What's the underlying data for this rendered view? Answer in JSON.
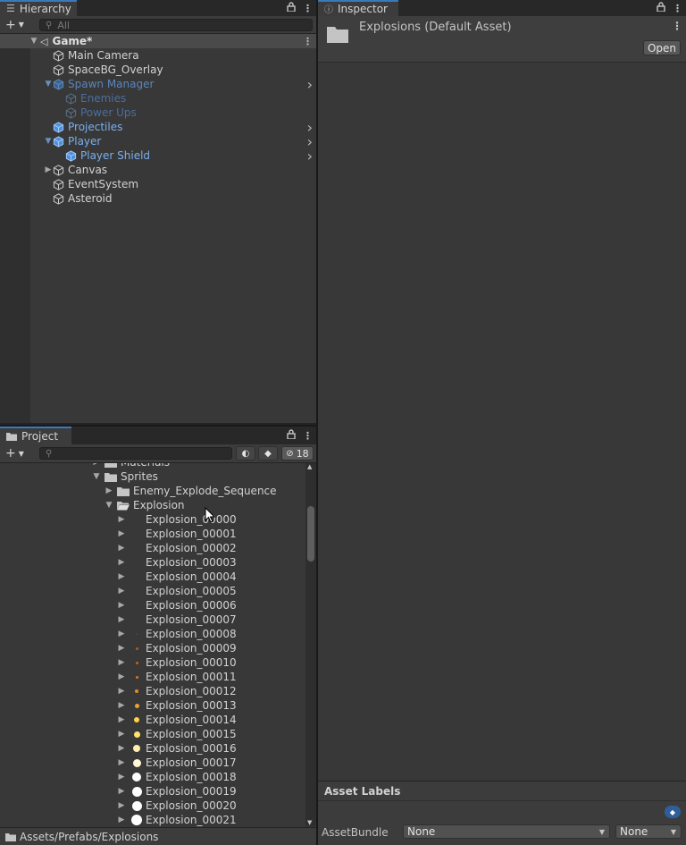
{
  "hierarchy": {
    "tab_label": "Hierarchy",
    "search_placeholder": "All",
    "scene_name": "Game*",
    "items": [
      {
        "label": "Main Camera",
        "indent": 1,
        "kind": "go"
      },
      {
        "label": "SpaceBG_Overlay",
        "indent": 1,
        "kind": "go"
      },
      {
        "label": "Spawn Manager",
        "indent": 1,
        "kind": "prefab-dim",
        "expanded": true,
        "has_more": true
      },
      {
        "label": "Enemies",
        "indent": 2,
        "kind": "prefab-dimmer"
      },
      {
        "label": "Power Ups",
        "indent": 2,
        "kind": "prefab-dimmer"
      },
      {
        "label": "Projectiles",
        "indent": 1,
        "kind": "prefab",
        "has_more": true
      },
      {
        "label": "Player",
        "indent": 1,
        "kind": "prefab",
        "expanded": true,
        "has_more": true
      },
      {
        "label": "Player Shield",
        "indent": 2,
        "kind": "prefab",
        "has_more": true
      },
      {
        "label": "Canvas",
        "indent": 1,
        "kind": "go",
        "collapsed": true
      },
      {
        "label": "EventSystem",
        "indent": 1,
        "kind": "go"
      },
      {
        "label": "Asteroid",
        "indent": 1,
        "kind": "go"
      }
    ]
  },
  "project": {
    "tab_label": "Project",
    "hidden_count": "18",
    "tree": [
      {
        "label": "Materials",
        "level": 0,
        "type": "folder"
      },
      {
        "label": "Sprites",
        "level": 0,
        "type": "folder",
        "expanded": true
      },
      {
        "label": "Enemy_Explode_Sequence",
        "level": 1,
        "type": "folder"
      },
      {
        "label": "Explosion",
        "level": 1,
        "type": "folder-open",
        "expanded": true
      }
    ],
    "sprites": [
      "Explosion_00000",
      "Explosion_00001",
      "Explosion_00002",
      "Explosion_00003",
      "Explosion_00004",
      "Explosion_00005",
      "Explosion_00006",
      "Explosion_00007",
      "Explosion_00008",
      "Explosion_00009",
      "Explosion_00010",
      "Explosion_00011",
      "Explosion_00012",
      "Explosion_00013",
      "Explosion_00014",
      "Explosion_00015",
      "Explosion_00016",
      "Explosion_00017",
      "Explosion_00018",
      "Explosion_00019",
      "Explosion_00020",
      "Explosion_00021"
    ],
    "path": "Assets/Prefabs/Explosions"
  },
  "inspector": {
    "tab_label": "Inspector",
    "asset_title": "Explosions (Default Asset)",
    "open_button": "Open",
    "asset_labels": "Asset Labels",
    "asset_bundle_label": "AssetBundle",
    "bundle_value": "None",
    "variant_value": "None"
  },
  "colors": {
    "accent": "#3a79bb",
    "prefab": "#7bafee",
    "panel": "#383838"
  }
}
